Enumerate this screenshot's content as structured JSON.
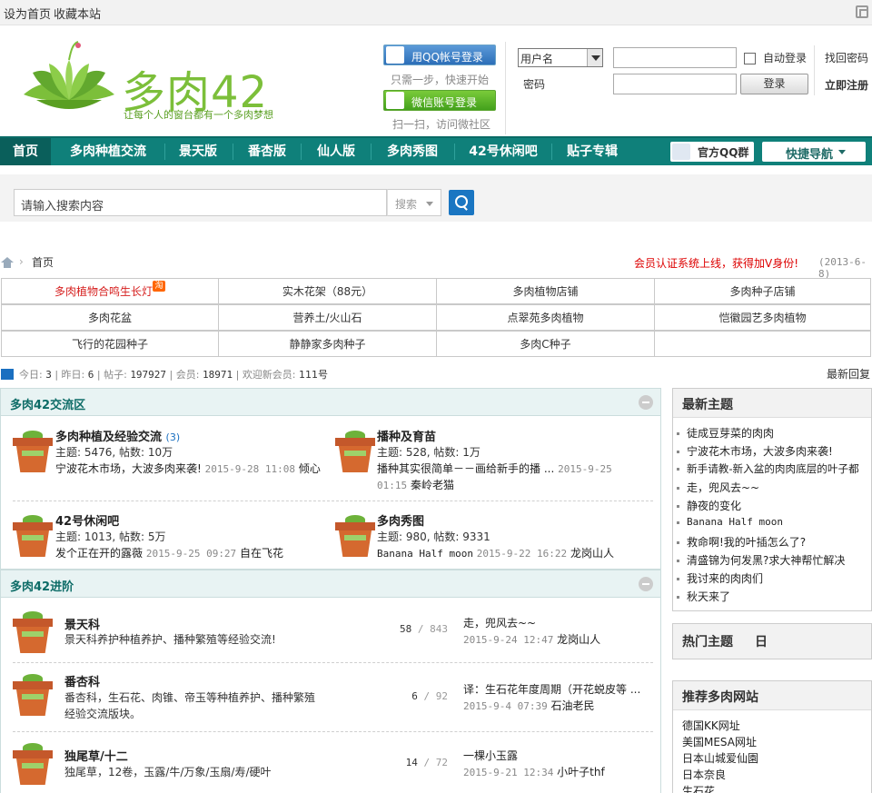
{
  "topbar": {
    "set_home": "设为首页",
    "bookmark": "收藏本站"
  },
  "logo": {
    "text": "多肉42",
    "slogan": "让每个人的窗台都有一个多肉梦想"
  },
  "social": {
    "qq_login": "用QQ帐号登录",
    "qq_note": "只需一步，快速开始",
    "wechat_login": "微信账号登录",
    "wechat_note": "扫一扫，访问微社区"
  },
  "login": {
    "username_select": "用户名",
    "password_label": "密码",
    "auto_login": "自动登录",
    "login_button": "登录",
    "find_password": "找回密码",
    "register": "立即注册"
  },
  "nav": {
    "items": [
      "首页",
      "多肉种植交流",
      "景天版",
      "番杏版",
      "仙人版",
      "多肉秀图",
      "42号休闲吧",
      "贴子专辑"
    ],
    "qq_group": "官方QQ群",
    "quick_nav": "快捷导航"
  },
  "search": {
    "placeholder": "请输入搜索内容",
    "scope": "搜索"
  },
  "breadcrumb": {
    "current": "首页",
    "separator": "›"
  },
  "notice": {
    "text": "会员认证系统上线，获得加V身份!",
    "date": "(2013-6-8)"
  },
  "links": [
    [
      "多肉植物合鸣生长灯",
      "实木花架（88元）",
      "多肉植物店铺",
      "多肉种子店铺"
    ],
    [
      "多肉花盆",
      "营养土/火山石",
      "点翠苑多肉植物",
      "恺徽园艺多肉植物"
    ],
    [
      "飞行的花园种子",
      "静静家多肉种子",
      "多肉C种子",
      ""
    ]
  ],
  "links_badge": "淘",
  "stats": {
    "today_label": "今日:",
    "today": "3",
    "yesterday_label": "昨日:",
    "yesterday": "6",
    "posts_label": "帖子:",
    "posts": "197927",
    "members_label": "会员:",
    "members": "18971",
    "welcome_label": "欢迎新会员:",
    "welcome": "111号",
    "latest_reply": "最新回复"
  },
  "section1": {
    "title": "多肉42交流区",
    "forums": [
      {
        "name": "多肉种植及经验交流",
        "count": "(3)",
        "meta": "主题: 5476, 帖数: 10万",
        "last_title": "宁波花木市场，大波多肉来袭!",
        "last_time": "2015-9-28 11:08",
        "last_user": "倾心"
      },
      {
        "name": "播种及育苗",
        "count": "",
        "meta": "主题: 528, 帖数: 1万",
        "last_title": "播种其实很简单－－画给新手的播 ...",
        "last_time": "2015-9-25 01:15",
        "last_user": "秦岭老猫",
        "last_time_a": "2015-9-25",
        "last_time_b": "01:15"
      },
      {
        "name": "42号休闲吧",
        "count": "",
        "meta": "主题: 1013, 帖数: 5万",
        "last_title": "发个正在开的露薇",
        "last_time": "2015-9-25 09:27",
        "last_user": "自在飞花"
      },
      {
        "name": "多肉秀图",
        "count": "",
        "meta": "主题: 980, 帖数: 9331",
        "last_title": "Banana Half moon",
        "last_time": "2015-9-22 16:22",
        "last_user": "龙岗山人"
      }
    ]
  },
  "section2": {
    "title": "多肉42进阶",
    "forums": [
      {
        "name": "景天科",
        "desc": "景天科养护种植养护、播种繁殖等经验交流!",
        "desc2": "",
        "topics": "58",
        "posts": "843",
        "last_title": "走，兜风去~~",
        "last_time": "2015-9-24 12:47",
        "last_user": "龙岗山人"
      },
      {
        "name": "番杏科",
        "desc": "番杏科，生石花、肉锥、帝玉等种植养护、播种繁殖",
        "desc2": "经验交流版块。",
        "topics": "6",
        "posts": "92",
        "last_title": "译：生石花年度周期（开花蜕皮等 ...",
        "last_time": "2015-9-4 07:39",
        "last_user": "石油老民"
      },
      {
        "name": "独尾草/十二",
        "desc": "独尾草，12卷，玉露/牛/万象/玉扇/寿/硬叶",
        "desc2": "",
        "topics": "14",
        "posts": "72",
        "last_title": "一棵小玉露",
        "last_time": "2015-9-21 12:34",
        "last_user": "小叶子thf"
      }
    ]
  },
  "sidebar": {
    "latest_title": "最新主题",
    "latest": [
      "徒成豆芽菜的肉肉",
      "宁波花木市场，大波多肉来袭!",
      "新手请教-新入盆的肉肉底层的叶子都",
      "走，兜风去~~",
      "静夜的变化",
      "Banana Half moon",
      "救命啊!我的叶插怎么了?",
      "清盛锦为何发黑?求大神帮忙解决",
      "我讨来的肉肉们",
      "秋天来了"
    ],
    "hot_title": "热门主题",
    "hot_tab": "日",
    "recommend_title": "推荐多肉网站",
    "recommend": [
      "德国KK网址",
      "美国MESA网址",
      "日本山城爱仙園",
      "日本奈良",
      "生石花"
    ]
  },
  "colors": {
    "nav": "#0f807a",
    "brand_green": "#7cbf3a",
    "notice_red": "#dd0000",
    "link_blue": "#1a6fc0"
  }
}
